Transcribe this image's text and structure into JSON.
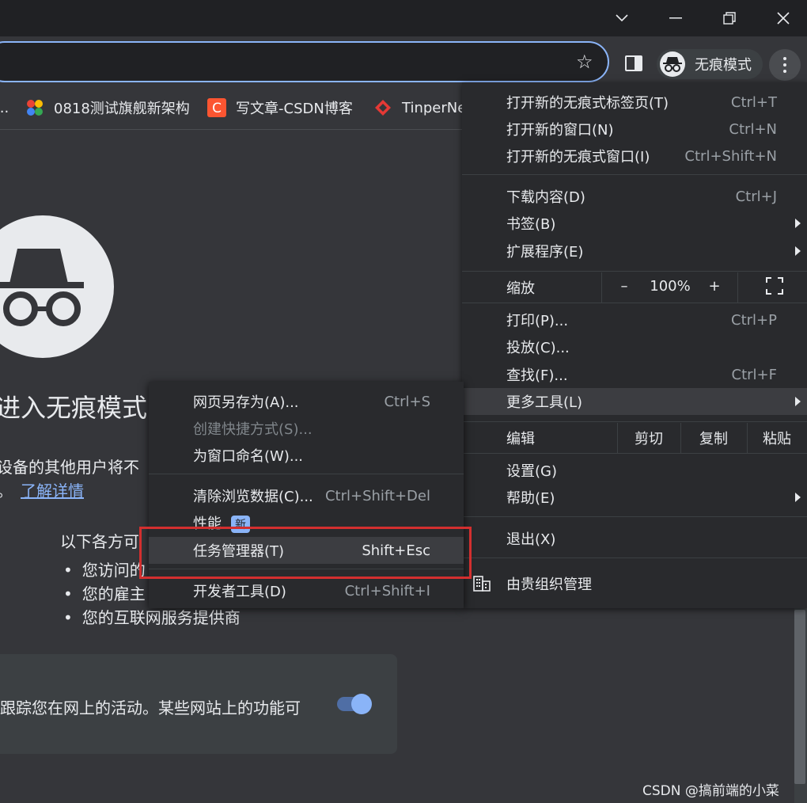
{
  "toolbar": {
    "incognito_label": "无痕模式"
  },
  "bookmarks": [
    {
      "label": "...",
      "icon": "ellipsis"
    },
    {
      "label": "0818测试旗舰新架构",
      "icon": "colorful-dots-icon"
    },
    {
      "label": "写文章-CSDN博客",
      "icon": "csdn-c-icon"
    },
    {
      "label": "TinperNe",
      "icon": "tinper-icon"
    }
  ],
  "page": {
    "title": "进入无痕模式",
    "line1": "设备的其他用户将不",
    "line2_prefix": "。",
    "learn_more": "了解详情",
    "list_heading": "以下各方可",
    "list_items": [
      "您访问的",
      "您的雇主",
      "您的互联网服务提供商"
    ],
    "card_text": "跟踪您在网上的活动。某些网站上的功能可"
  },
  "menu": {
    "items": [
      {
        "label": "打开新的无痕式标签页(T)",
        "shortcut": "Ctrl+T"
      },
      {
        "label": "打开新的窗口(N)",
        "shortcut": "Ctrl+N"
      },
      {
        "label": "打开新的无痕式窗口(I)",
        "shortcut": "Ctrl+Shift+N"
      },
      {
        "label": "下载内容(D)",
        "shortcut": "Ctrl+J"
      },
      {
        "label": "书签(B)",
        "shortcut": ""
      },
      {
        "label": "扩展程序(E)",
        "shortcut": ""
      },
      {
        "label": "打印(P)...",
        "shortcut": "Ctrl+P"
      },
      {
        "label": "投放(C)...",
        "shortcut": ""
      },
      {
        "label": "查找(F)...",
        "shortcut": "Ctrl+F"
      },
      {
        "label": "更多工具(L)",
        "shortcut": ""
      },
      {
        "label": "设置(G)",
        "shortcut": ""
      },
      {
        "label": "帮助(E)",
        "shortcut": ""
      },
      {
        "label": "退出(X)",
        "shortcut": ""
      }
    ],
    "zoom": {
      "label": "缩放",
      "minus": "–",
      "value": "100%",
      "plus": "+"
    },
    "edit": {
      "label": "编辑",
      "cut": "剪切",
      "copy": "复制",
      "paste": "粘贴"
    },
    "managed": "由贵组织管理"
  },
  "submenu": {
    "items": [
      {
        "label": "网页另存为(A)...",
        "shortcut": "Ctrl+S"
      },
      {
        "label": "创建快捷方式(S)...",
        "shortcut": ""
      },
      {
        "label": "为窗口命名(W)...",
        "shortcut": ""
      },
      {
        "label": "清除浏览数据(C)...",
        "shortcut": "Ctrl+Shift+Del"
      },
      {
        "label": "性能",
        "shortcut": ""
      },
      {
        "label": "任务管理器(T)",
        "shortcut": "Shift+Esc"
      },
      {
        "label": "开发者工具(D)",
        "shortcut": "Ctrl+Shift+I"
      }
    ],
    "new_badge": "新"
  },
  "watermark": "CSDN @搞前端的小菜"
}
